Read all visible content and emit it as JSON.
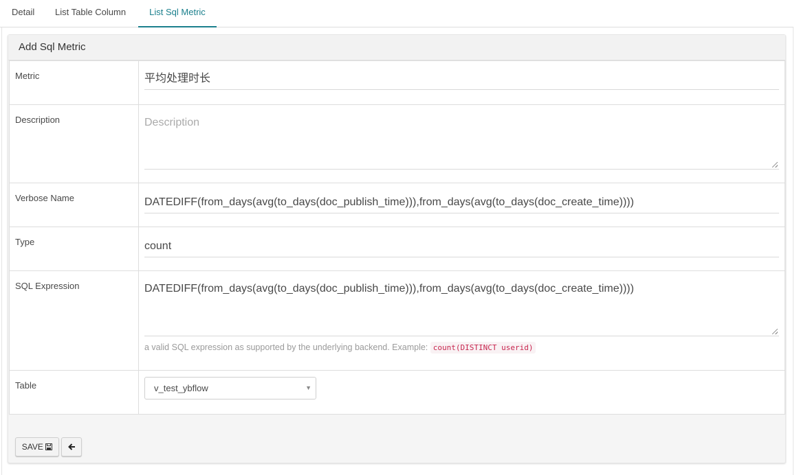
{
  "tabs": [
    {
      "label": "Detail"
    },
    {
      "label": "List Table Column"
    },
    {
      "label": "List Sql Metric"
    }
  ],
  "panel": {
    "title": "Add Sql Metric"
  },
  "form": {
    "metric": {
      "label": "Metric",
      "value": "平均处理时长"
    },
    "description": {
      "label": "Description",
      "placeholder": "Description"
    },
    "verbose_name": {
      "label": "Verbose Name",
      "value": "DATEDIFF(from_days(avg(to_days(doc_publish_time))),from_days(avg(to_days(doc_create_time))))"
    },
    "type": {
      "label": "Type",
      "value": "count"
    },
    "sql_expression": {
      "label": "SQL Expression",
      "value": "DATEDIFF(from_days(avg(to_days(doc_publish_time))),from_days(avg(to_days(doc_create_time))))",
      "help_text": "a valid SQL expression as supported by the underlying backend. Example:",
      "help_code": "count(DISTINCT userid)"
    },
    "table": {
      "label": "Table",
      "selected": "v_test_ybflow",
      "caret": "▼"
    }
  },
  "actions": {
    "save_label": "SAVE",
    "save_icon": "floppy-disk-icon",
    "back_icon": "arrow-left-icon"
  },
  "colors": {
    "accent": "#1a7f8c",
    "code": "#c7254e"
  }
}
